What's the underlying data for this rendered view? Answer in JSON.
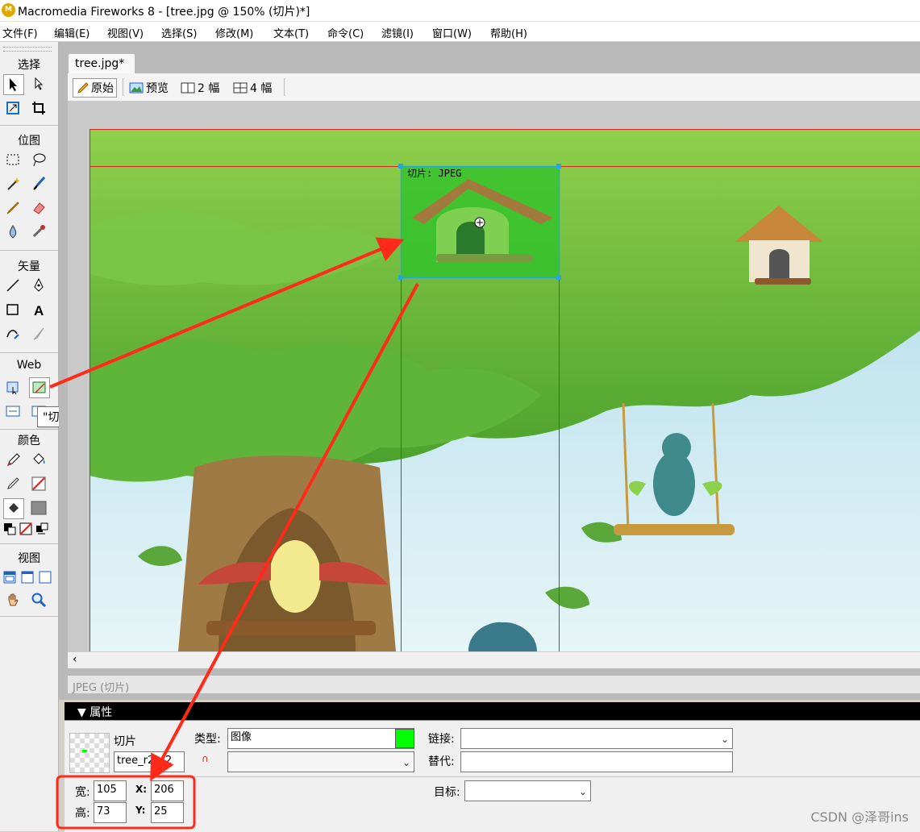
{
  "window": {
    "title": "Macromedia Fireworks 8 - [tree.jpg @ 150% (切片)*]"
  },
  "menu": [
    "文件(F)",
    "编辑(E)",
    "视图(V)",
    "选择(S)",
    "修改(M)",
    "文本(T)",
    "命令(C)",
    "滤镜(I)",
    "窗口(W)",
    "帮助(H)"
  ],
  "tools": {
    "sections": [
      "选择",
      "位图",
      "矢量",
      "Web",
      "颜色",
      "视图"
    ],
    "tooltip": "\"切片\"工具 (K)"
  },
  "document": {
    "tab_label": "tree.jpg*",
    "view_buttons": [
      "原始",
      "预览",
      "2 幅",
      "4 幅"
    ],
    "slice_label": "切片: JPEG",
    "status_text": "JPEG (切片)"
  },
  "properties": {
    "panel_title": "▼ 属性",
    "object_type": "切片",
    "slice_name": "tree_r2_c2",
    "type_label": "类型:",
    "type_value": "图像",
    "link_label": "链接:",
    "link_value": "",
    "alt_label": "替代:",
    "alt_value": "",
    "target_label": "目标:",
    "target_value": "",
    "width_label": "宽:",
    "width": "105",
    "height_label": "高:",
    "height": "73",
    "x_label": "X:",
    "x": "206",
    "y_label": "Y:",
    "y": "25",
    "slice_color": "#00ff00"
  },
  "colors": {
    "annotation": "#ff2a1a",
    "slice_overlay": "#27c227",
    "stroke_swatch": "#e02020",
    "fill_swatch": "#8c8c8c"
  },
  "watermark": "CSDN @泽哥ins"
}
